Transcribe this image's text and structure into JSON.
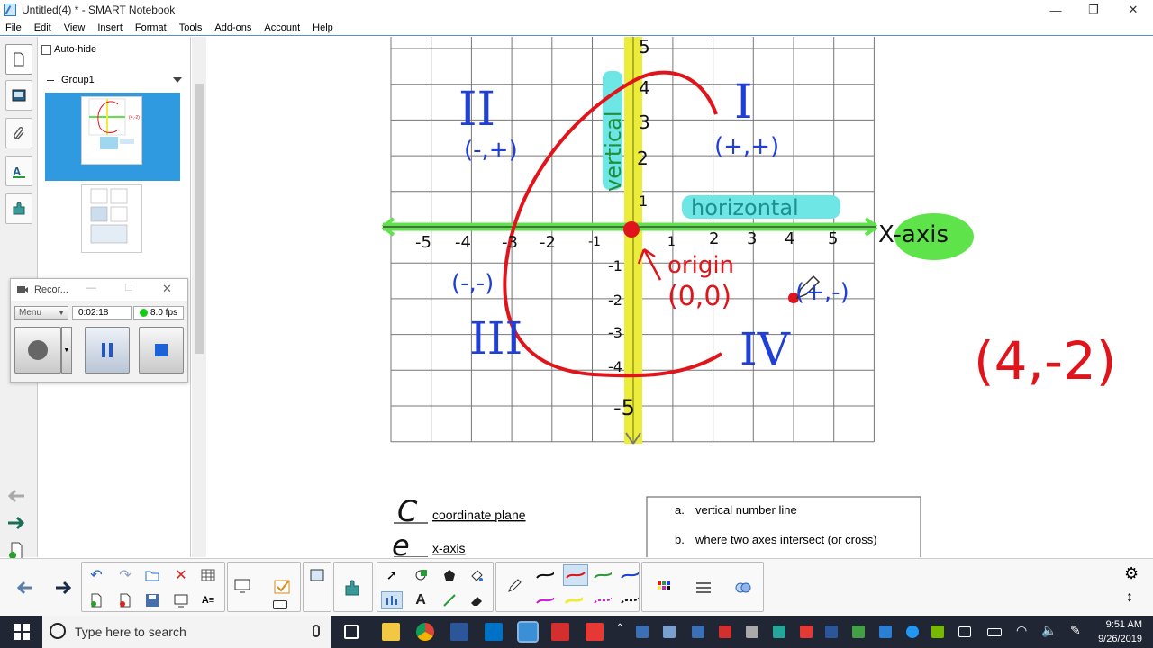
{
  "window": {
    "title": "Untitled(4) * - SMART Notebook",
    "minimize": "—",
    "maximize": "❐",
    "close": "✕"
  },
  "menu": [
    "File",
    "Edit",
    "View",
    "Insert",
    "Format",
    "Tools",
    "Add-ons",
    "Account",
    "Help"
  ],
  "sorter": {
    "autohide_label": "Auto-hide",
    "group_label": "Group1",
    "pages": [
      "1",
      "2"
    ]
  },
  "recorder": {
    "title": "Recor...",
    "menu_label": "Menu",
    "time": "0:02:18",
    "fps": "8.0 fps"
  },
  "whiteboard": {
    "quadrants": [
      "II",
      "I",
      "III",
      "IV"
    ],
    "quadrant_signs": [
      "(-,+)",
      "(+,+)",
      "(-,-)",
      "(+,-)"
    ],
    "x_ticks": [
      "-5",
      "-4",
      "-3",
      "-2",
      "-1",
      "1",
      "2",
      "3",
      "4",
      "5"
    ],
    "y_ticks": [
      "5",
      "4",
      "3",
      "2",
      "1",
      "-1",
      "-2",
      "-3",
      "-4",
      "-5"
    ],
    "vertical_label": "vertical",
    "horizontal_label": "horizontal",
    "x_axis_label": "X-axis",
    "origin_label": "origin",
    "origin_coords": "(0,0)",
    "point_label": "(4,-2)",
    "answer_letter_1": "C",
    "answer_letter_2": "e",
    "term_1": "coordinate plane",
    "term_2": "x-axis",
    "definition_a_letter": "a.",
    "definition_a": "vertical number line",
    "definition_b_letter": "b.",
    "definition_b": "where two axes intersect (or cross)"
  },
  "taskbar": {
    "search_placeholder": "Type here to search",
    "time": "9:51 AM",
    "date": "9/26/2019"
  },
  "colors": {
    "ink_blue": "#1f3fd6",
    "ink_red": "#e0141a",
    "highlight_green": "#5fe34a",
    "highlight_yellow": "#ecec3a",
    "highlight_cyan": "#6ee6e6",
    "accent": "#2f9ae0"
  }
}
